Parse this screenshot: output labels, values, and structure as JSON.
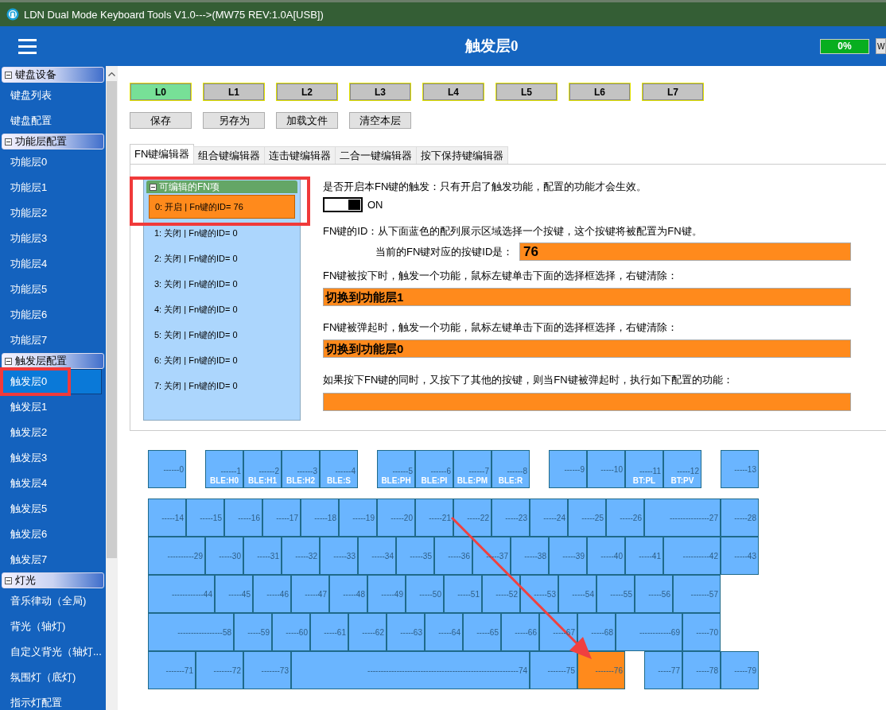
{
  "window": {
    "title": "LDN Dual Mode Keyboard Tools V1.0--->(MW75 REV:1.0A[USB])"
  },
  "header": {
    "title": "触发层0",
    "progress": {
      "label": "0%"
    },
    "cut_button": "W"
  },
  "sidebar": {
    "groups": [
      {
        "label": "键盘设备",
        "expanded": true,
        "items": [
          {
            "label": "键盘列表",
            "selected": false
          },
          {
            "label": "键盘配置",
            "selected": false
          }
        ]
      },
      {
        "label": "功能层配置",
        "expanded": true,
        "items": [
          {
            "label": "功能层0",
            "selected": false
          },
          {
            "label": "功能层1",
            "selected": false
          },
          {
            "label": "功能层2",
            "selected": false
          },
          {
            "label": "功能层3",
            "selected": false
          },
          {
            "label": "功能层4",
            "selected": false
          },
          {
            "label": "功能层5",
            "selected": false
          },
          {
            "label": "功能层6",
            "selected": false
          },
          {
            "label": "功能层7",
            "selected": false
          }
        ]
      },
      {
        "label": "触发层配置",
        "expanded": true,
        "items": [
          {
            "label": "触发层0",
            "selected": true
          },
          {
            "label": "触发层1",
            "selected": false
          },
          {
            "label": "触发层2",
            "selected": false
          },
          {
            "label": "触发层3",
            "selected": false
          },
          {
            "label": "触发层4",
            "selected": false
          },
          {
            "label": "触发层5",
            "selected": false
          },
          {
            "label": "触发层6",
            "selected": false
          },
          {
            "label": "触发层7",
            "selected": false
          }
        ]
      },
      {
        "label": "灯光",
        "expanded": true,
        "items": [
          {
            "label": "音乐律动（全局)",
            "selected": false
          },
          {
            "label": "背光（轴灯)",
            "selected": false
          },
          {
            "label": "自定义背光（轴灯...",
            "selected": false
          },
          {
            "label": "氛围灯（底灯)",
            "selected": false
          },
          {
            "label": "指示灯配置",
            "selected": false
          }
        ]
      }
    ]
  },
  "layers": [
    {
      "label": "L0",
      "selected": true
    },
    {
      "label": "L1",
      "selected": false
    },
    {
      "label": "L2",
      "selected": false
    },
    {
      "label": "L3",
      "selected": false
    },
    {
      "label": "L4",
      "selected": false
    },
    {
      "label": "L5",
      "selected": false
    },
    {
      "label": "L6",
      "selected": false
    },
    {
      "label": "L7",
      "selected": false
    }
  ],
  "actions": [
    "保存",
    "另存为",
    "加载文件",
    "清空本层"
  ],
  "tabs": [
    {
      "label": "FN键编辑器",
      "selected": true
    },
    {
      "label": "组合键编辑器",
      "selected": false
    },
    {
      "label": "连击键编辑器",
      "selected": false
    },
    {
      "label": "二合一键编辑器",
      "selected": false
    },
    {
      "label": "按下保持键编辑器",
      "selected": false
    }
  ],
  "fn_list": {
    "title": "可编辑的FN项",
    "expanded": true,
    "items": [
      {
        "label": "0: 开启 | Fn键的ID= 76",
        "selected": true
      },
      {
        "label": "1: 关闭 | Fn键的ID= 0",
        "selected": false
      },
      {
        "label": "2: 关闭 | Fn键的ID= 0",
        "selected": false
      },
      {
        "label": "3: 关闭 | Fn键的ID= 0",
        "selected": false
      },
      {
        "label": "4: 关闭 | Fn键的ID= 0",
        "selected": false
      },
      {
        "label": "5: 关闭 | Fn键的ID= 0",
        "selected": false
      },
      {
        "label": "6: 关闭 | Fn键的ID= 0",
        "selected": false
      },
      {
        "label": "7: 关闭 | Fn键的ID= 0",
        "selected": false
      }
    ]
  },
  "fn_settings": {
    "enable_prompt": "是否开启本FN键的触发：只有开启了触发功能，配置的功能才会生效。",
    "toggle": {
      "on": true,
      "label": "ON"
    },
    "id_prompt": "FN键的ID：从下面蓝色的配列展示区域选择一个按键，这个按键将被配置为FN键。",
    "id_label": "当前的FN键对应的按键ID是：",
    "id_value": "76",
    "press_prompt": "FN键被按下时，触发一个功能，鼠标左键单击下面的选择框选择，右键清除：",
    "press_value": "切换到功能层1",
    "release_prompt": "FN键被弹起时，触发一个功能，鼠标左键单击下面的选择框选择，右键清除：",
    "release_value": "切换到功能层0",
    "combo_prompt": "如果按下FN键的同时，又按下了其他的按键，则当FN键被弹起时，执行如下配置的功能："
  },
  "keyboard": {
    "rows": [
      {
        "keys": [
          {
            "label": "------0",
            "selected": false
          },
          {
            "kind": "gap"
          },
          {
            "label": "------1",
            "sub": "BLE:H0",
            "selected": false
          },
          {
            "label": "------2",
            "sub": "BLE:H1",
            "selected": false
          },
          {
            "label": "------3",
            "sub": "BLE:H2",
            "selected": false
          },
          {
            "label": "------4",
            "sub": "BLE:S",
            "selected": false
          },
          {
            "kind": "gap"
          },
          {
            "label": "------5",
            "sub": "BLE:PH",
            "selected": false
          },
          {
            "label": "------6",
            "sub": "BLE:PI",
            "selected": false
          },
          {
            "label": "------7",
            "sub": "BLE:PM",
            "selected": false
          },
          {
            "label": "------8",
            "sub": "BLE:R",
            "selected": false
          },
          {
            "kind": "gap"
          },
          {
            "label": "------9",
            "selected": false
          },
          {
            "label": "-----10",
            "selected": false
          },
          {
            "label": "-----11",
            "sub": "BT:PL",
            "selected": false
          },
          {
            "label": "-----12",
            "sub": "BT:PV",
            "selected": false
          },
          {
            "kind": "gap"
          },
          {
            "label": "-----13",
            "selected": false
          }
        ]
      },
      {
        "keys": [
          {
            "label": "-----14",
            "selected": false
          },
          {
            "label": "-----15",
            "selected": false
          },
          {
            "label": "-----16",
            "selected": false
          },
          {
            "label": "-----17",
            "selected": false
          },
          {
            "label": "-----18",
            "selected": false
          },
          {
            "label": "-----19",
            "selected": false
          },
          {
            "label": "-----20",
            "selected": false
          },
          {
            "label": "-----21",
            "selected": false
          },
          {
            "label": "-----22",
            "selected": false
          },
          {
            "label": "-----23",
            "selected": false
          },
          {
            "label": "-----24",
            "selected": false
          },
          {
            "label": "-----25",
            "selected": false
          },
          {
            "label": "-----26",
            "selected": false
          },
          {
            "label": "---------------27",
            "selected": false
          },
          {
            "label": "-----28",
            "selected": false
          }
        ]
      },
      {
        "keys": [
          {
            "label": "----------29",
            "selected": false
          },
          {
            "label": "-----30",
            "selected": false
          },
          {
            "label": "-----31",
            "selected": false
          },
          {
            "label": "-----32",
            "selected": false
          },
          {
            "label": "-----33",
            "selected": false
          },
          {
            "label": "-----34",
            "selected": false
          },
          {
            "label": "-----35",
            "selected": false
          },
          {
            "label": "-----36",
            "selected": false
          },
          {
            "label": "-----37",
            "selected": false
          },
          {
            "label": "-----38",
            "selected": false
          },
          {
            "label": "-----39",
            "selected": false
          },
          {
            "label": "-----40",
            "selected": false
          },
          {
            "label": "-----41",
            "selected": false
          },
          {
            "label": "----------42",
            "selected": false
          },
          {
            "label": "-----43",
            "selected": false
          }
        ]
      },
      {
        "keys": [
          {
            "label": "------------44",
            "selected": false
          },
          {
            "label": "-----45",
            "selected": false
          },
          {
            "label": "-----46",
            "selected": false
          },
          {
            "label": "-----47",
            "selected": false
          },
          {
            "label": "-----48",
            "selected": false
          },
          {
            "label": "-----49",
            "selected": false
          },
          {
            "label": "-----50",
            "selected": false
          },
          {
            "label": "-----51",
            "selected": false
          },
          {
            "label": "-----52",
            "selected": false
          },
          {
            "label": "-----53",
            "selected": false
          },
          {
            "label": "-----54",
            "selected": false
          },
          {
            "label": "-----55",
            "selected": false
          },
          {
            "label": "-----56",
            "selected": false
          },
          {
            "label": "-------57",
            "selected": false
          }
        ]
      },
      {
        "keys": [
          {
            "label": "-----------------58",
            "selected": false
          },
          {
            "label": "-----59",
            "selected": false
          },
          {
            "label": "-----60",
            "selected": false
          },
          {
            "label": "-----61",
            "selected": false
          },
          {
            "label": "-----62",
            "selected": false
          },
          {
            "label": "-----63",
            "selected": false
          },
          {
            "label": "-----64",
            "selected": false
          },
          {
            "label": "-----65",
            "selected": false
          },
          {
            "label": "-----66",
            "selected": false
          },
          {
            "label": "-----67",
            "selected": false
          },
          {
            "label": "-----68",
            "selected": false
          },
          {
            "label": "------------69",
            "selected": false
          },
          {
            "label": "-----70",
            "selected": false
          }
        ]
      },
      {
        "keys": [
          {
            "label": "-------71",
            "selected": false
          },
          {
            "label": "-------72",
            "selected": false
          },
          {
            "label": "-------73",
            "selected": false
          },
          {
            "label": "---------------------------------------------------------74",
            "selected": false
          },
          {
            "label": "-------75",
            "selected": false
          },
          {
            "label": "-------76",
            "selected": true
          },
          {
            "kind": "gap"
          },
          {
            "label": "-----77",
            "selected": false
          },
          {
            "label": "-----78",
            "selected": false
          },
          {
            "label": "-----79",
            "selected": false
          }
        ]
      }
    ]
  }
}
